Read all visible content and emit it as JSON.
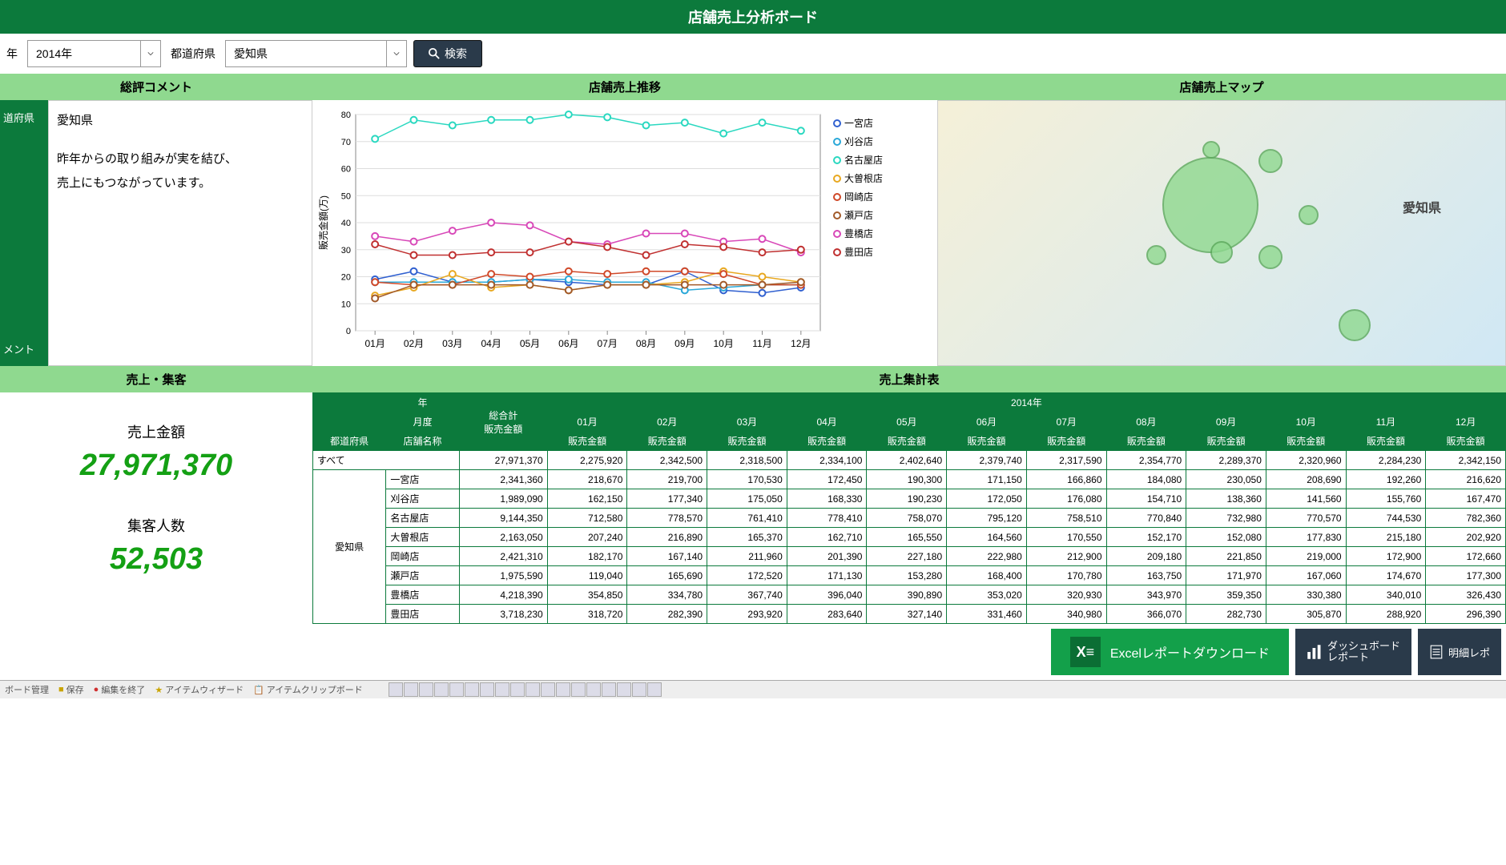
{
  "header": {
    "title": "店舗売上分析ボード"
  },
  "filters": {
    "year_label_suffix": "年",
    "year_value": "2014年",
    "pref_label": "都道府県",
    "pref_value": "愛知県",
    "search_label": "検索"
  },
  "sections": {
    "comment": "総評コメント",
    "trend": "店舗売上推移",
    "map": "店舗売上マップ",
    "kpi": "売上・集客",
    "table": "売上集計表"
  },
  "comment_side": {
    "top": "道府県",
    "bottom": "メント"
  },
  "comment": {
    "pref": "愛知県",
    "line1": "昨年からの取り組みが実を結び、",
    "line2": "売上にもつながっています。"
  },
  "chart_data": {
    "type": "line",
    "xlabel": "",
    "ylabel": "販売金額(万)",
    "ylim": [
      0,
      80
    ],
    "categories": [
      "01月",
      "02月",
      "03月",
      "04月",
      "05月",
      "06月",
      "07月",
      "08月",
      "09月",
      "10月",
      "11月",
      "12月"
    ],
    "series": [
      {
        "name": "一宮店",
        "color": "#3060d0",
        "values": [
          19,
          22,
          18,
          18,
          19,
          18,
          17,
          17,
          22,
          15,
          14,
          16
        ]
      },
      {
        "name": "刈谷店",
        "color": "#2aa8d8",
        "values": [
          18,
          18,
          18,
          18,
          19,
          19,
          18,
          18,
          15,
          16,
          17,
          17
        ]
      },
      {
        "name": "名古屋店",
        "color": "#2ad8c0",
        "values": [
          71,
          78,
          76,
          78,
          78,
          80,
          79,
          76,
          77,
          73,
          77,
          74
        ]
      },
      {
        "name": "大曽根店",
        "color": "#e8a820",
        "values": [
          13,
          16,
          21,
          16,
          17,
          15,
          17,
          17,
          18,
          22,
          20,
          18
        ]
      },
      {
        "name": "岡崎店",
        "color": "#d04828",
        "values": [
          18,
          17,
          17,
          21,
          20,
          22,
          21,
          22,
          22,
          21,
          17,
          17
        ]
      },
      {
        "name": "瀬戸店",
        "color": "#a25a2a",
        "values": [
          12,
          17,
          17,
          17,
          17,
          15,
          17,
          17,
          17,
          17,
          17,
          18
        ]
      },
      {
        "name": "豊橋店",
        "color": "#d848b8",
        "values": [
          35,
          33,
          37,
          40,
          39,
          33,
          32,
          36,
          36,
          33,
          34,
          29
        ]
      },
      {
        "name": "豊田店",
        "color": "#c03030",
        "values": [
          32,
          28,
          28,
          29,
          29,
          33,
          31,
          28,
          32,
          31,
          29,
          30
        ]
      }
    ]
  },
  "map": {
    "region_label": "愛知県"
  },
  "kpi": {
    "sales_label": "売上金額",
    "sales_value": "27,971,370",
    "customers_label": "集客人数",
    "customers_value": "52,503"
  },
  "table": {
    "header_year": "年",
    "header_month": "月度",
    "header_total": "総合計",
    "header_pref": "都道府県",
    "header_store": "店舗名称",
    "header_amount": "販売金額",
    "header_year_value": "2014年",
    "months": [
      "01月",
      "02月",
      "03月",
      "04月",
      "05月",
      "06月",
      "07月",
      "08月",
      "09月",
      "10月",
      "11月",
      "12月"
    ],
    "pref": "愛知県",
    "all_label": "すべて",
    "rows": [
      {
        "store": "すべて",
        "total": "27,971,370",
        "m": [
          "2,275,920",
          "2,342,500",
          "2,318,500",
          "2,334,100",
          "2,402,640",
          "2,379,740",
          "2,317,590",
          "2,354,770",
          "2,289,370",
          "2,320,960",
          "2,284,230",
          "2,342,150"
        ]
      },
      {
        "store": "一宮店",
        "total": "2,341,360",
        "m": [
          "218,670",
          "219,700",
          "170,530",
          "172,450",
          "190,300",
          "171,150",
          "166,860",
          "184,080",
          "230,050",
          "208,690",
          "192,260",
          "216,620"
        ]
      },
      {
        "store": "刈谷店",
        "total": "1,989,090",
        "m": [
          "162,150",
          "177,340",
          "175,050",
          "168,330",
          "190,230",
          "172,050",
          "176,080",
          "154,710",
          "138,360",
          "141,560",
          "155,760",
          "167,470"
        ]
      },
      {
        "store": "名古屋店",
        "total": "9,144,350",
        "m": [
          "712,580",
          "778,570",
          "761,410",
          "778,410",
          "758,070",
          "795,120",
          "758,510",
          "770,840",
          "732,980",
          "770,570",
          "744,530",
          "782,360"
        ]
      },
      {
        "store": "大曽根店",
        "total": "2,163,050",
        "m": [
          "207,240",
          "216,890",
          "165,370",
          "162,710",
          "165,550",
          "164,560",
          "170,550",
          "152,170",
          "152,080",
          "177,830",
          "215,180",
          "202,920"
        ]
      },
      {
        "store": "岡崎店",
        "total": "2,421,310",
        "m": [
          "182,170",
          "167,140",
          "211,960",
          "201,390",
          "227,180",
          "222,980",
          "212,900",
          "209,180",
          "221,850",
          "219,000",
          "172,900",
          "172,660"
        ]
      },
      {
        "store": "瀬戸店",
        "total": "1,975,590",
        "m": [
          "119,040",
          "165,690",
          "172,520",
          "171,130",
          "153,280",
          "168,400",
          "170,780",
          "163,750",
          "171,970",
          "167,060",
          "174,670",
          "177,300"
        ]
      },
      {
        "store": "豊橋店",
        "total": "4,218,390",
        "m": [
          "354,850",
          "334,780",
          "367,740",
          "396,040",
          "390,890",
          "353,020",
          "320,930",
          "343,970",
          "359,350",
          "330,380",
          "340,010",
          "326,430"
        ]
      },
      {
        "store": "豊田店",
        "total": "3,718,230",
        "m": [
          "318,720",
          "282,390",
          "293,920",
          "283,640",
          "327,140",
          "331,460",
          "340,980",
          "366,070",
          "282,730",
          "305,870",
          "288,920",
          "296,390"
        ]
      }
    ]
  },
  "footer": {
    "excel": "Excelレポートダウンロード",
    "dash_report_l1": "ダッシュボード",
    "dash_report_l2": "レポート",
    "detail_report": "明細レポ"
  },
  "statusbar": {
    "item1": "ボード管理",
    "item2": "保存",
    "item3": "編集を終了",
    "item4": "アイテムウィザード",
    "item5": "アイテムクリップボード"
  }
}
